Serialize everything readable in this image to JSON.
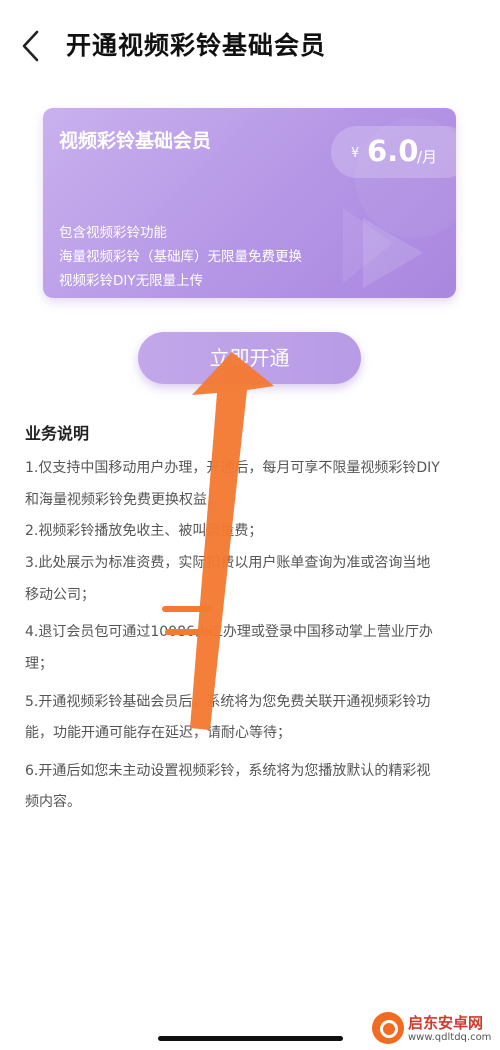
{
  "header": {
    "title": "开通视频彩铃基础会员"
  },
  "card": {
    "title": "视频彩铃基础会员",
    "price_currency": "¥",
    "price_value": "6.0",
    "price_unit": "/月",
    "features": [
      "包含视频彩铃功能",
      "海量视频彩铃（基础库）无限量免费更换",
      "视频彩铃DIY无限量上传"
    ]
  },
  "action": {
    "open_label": "立即开通"
  },
  "description": {
    "title": "业务说明",
    "lines": [
      "1.仅支持中国移动用户办理，开通后，每月可享不限量视频彩铃DIY",
      "和海量视频彩铃免费更换权益；",
      "2.视频彩铃播放免收主、被叫流量费；",
      "3.此处展示为标准资费，实际扣费以用户账单查询为准或咨询当地",
      "移动公司；",
      "4.退订会员包可通过10086人工办理或登录中国移动掌上营业厅办",
      "理；",
      "5.开通视频彩铃基础会员后，系统将为您免费关联开通视频彩铃功",
      "能，功能开通可能存在延迟，请耐心等待；",
      "6.开通后如您未主动设置视频彩铃，系统将为您播放默认的精彩视",
      "频内容。"
    ]
  },
  "watermark": {
    "name": "启东安卓网",
    "url": "www.qdltdq.com"
  },
  "colors": {
    "card_purple": "#b596e6",
    "annotation_arrow": "#f47a32"
  }
}
